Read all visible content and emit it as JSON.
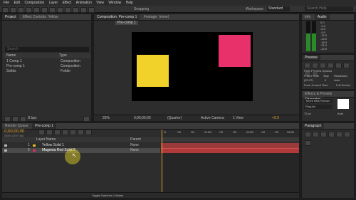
{
  "menu": [
    "File",
    "Edit",
    "Composition",
    "Layer",
    "Effect",
    "Animation",
    "View",
    "Window",
    "Help"
  ],
  "toolbar": {
    "snapping": "Snapping",
    "workspace_label": "Workspace",
    "workspace": "Standard",
    "search_placeholder": "Search Help"
  },
  "project": {
    "tab": "Project",
    "effect_tab": "Effect Controls: Yellow",
    "search_placeholder": "Search",
    "col_name": "Name",
    "col_type": "Type",
    "items": [
      {
        "name": "1 Comp 1",
        "type": "Composition"
      },
      {
        "name": "Pre-comp 1",
        "type": "Composition"
      },
      {
        "name": "Solids",
        "type": "Folder"
      }
    ],
    "bpc": "8 bpc"
  },
  "comp_viewer": {
    "tab": "Composition: Pre-comp 1",
    "footage_tab": "Footage: (none)",
    "breadcrumb": "Pre-comp 1",
    "zoom": "25%",
    "timecode": "0;00;00;00",
    "resolution": "(Quarter)",
    "camera": "Active Camera",
    "views": "1 View",
    "exposure": "+0.0"
  },
  "canvas": {
    "bg": "#000000",
    "yellow": "#f0d22a",
    "magenta": "#e8306a"
  },
  "timeline": {
    "tab_render": "Render Queue",
    "tab_comp": "Pre-comp 1",
    "timecode": "0;00;00;00",
    "fps": "00000 (29.97 fps)",
    "col_layer": "Layer Name",
    "col_parent": "Parent",
    "layers": [
      {
        "num": "1",
        "name": "Yellow Solid 1",
        "color": "#e0c020",
        "parent": "None"
      },
      {
        "num": "2",
        "name": "Magenta Red Solid 2",
        "color": "#e0306a",
        "parent": "None"
      }
    ],
    "ruler": [
      "0f",
      "10f",
      "20f",
      "01:00f",
      "10f",
      "20f",
      "02:00f",
      "10f",
      "20f",
      "03:00f"
    ],
    "toggle": "Toggle Switches / Modes"
  },
  "info": {
    "tab": "Info",
    "audio_tab": "Audio",
    "db_labels": [
      "0.0",
      "-3.0",
      "-6.0",
      "-9.0",
      "-12.0",
      "-15.0",
      "-18.0",
      "-21.0",
      "-24.0"
    ]
  },
  "preview": {
    "tab": "Preview",
    "ram_options": "RAM Preview Options",
    "frame_rate": "Frame Rate",
    "skip": "Skip",
    "resolution": "Resolution",
    "fr_val": "(29.97)",
    "skip_val": "0",
    "res_val": "Auto",
    "from_current": "From Current Time",
    "full_screen": "Full Screen"
  },
  "character": {
    "tabs": [
      "Effects & Presets",
      "Character"
    ],
    "font": "Times New Roman",
    "style": "Regular",
    "size": "72 px",
    "auto": "Auto"
  },
  "paragraph": {
    "tab": "Paragraph"
  }
}
